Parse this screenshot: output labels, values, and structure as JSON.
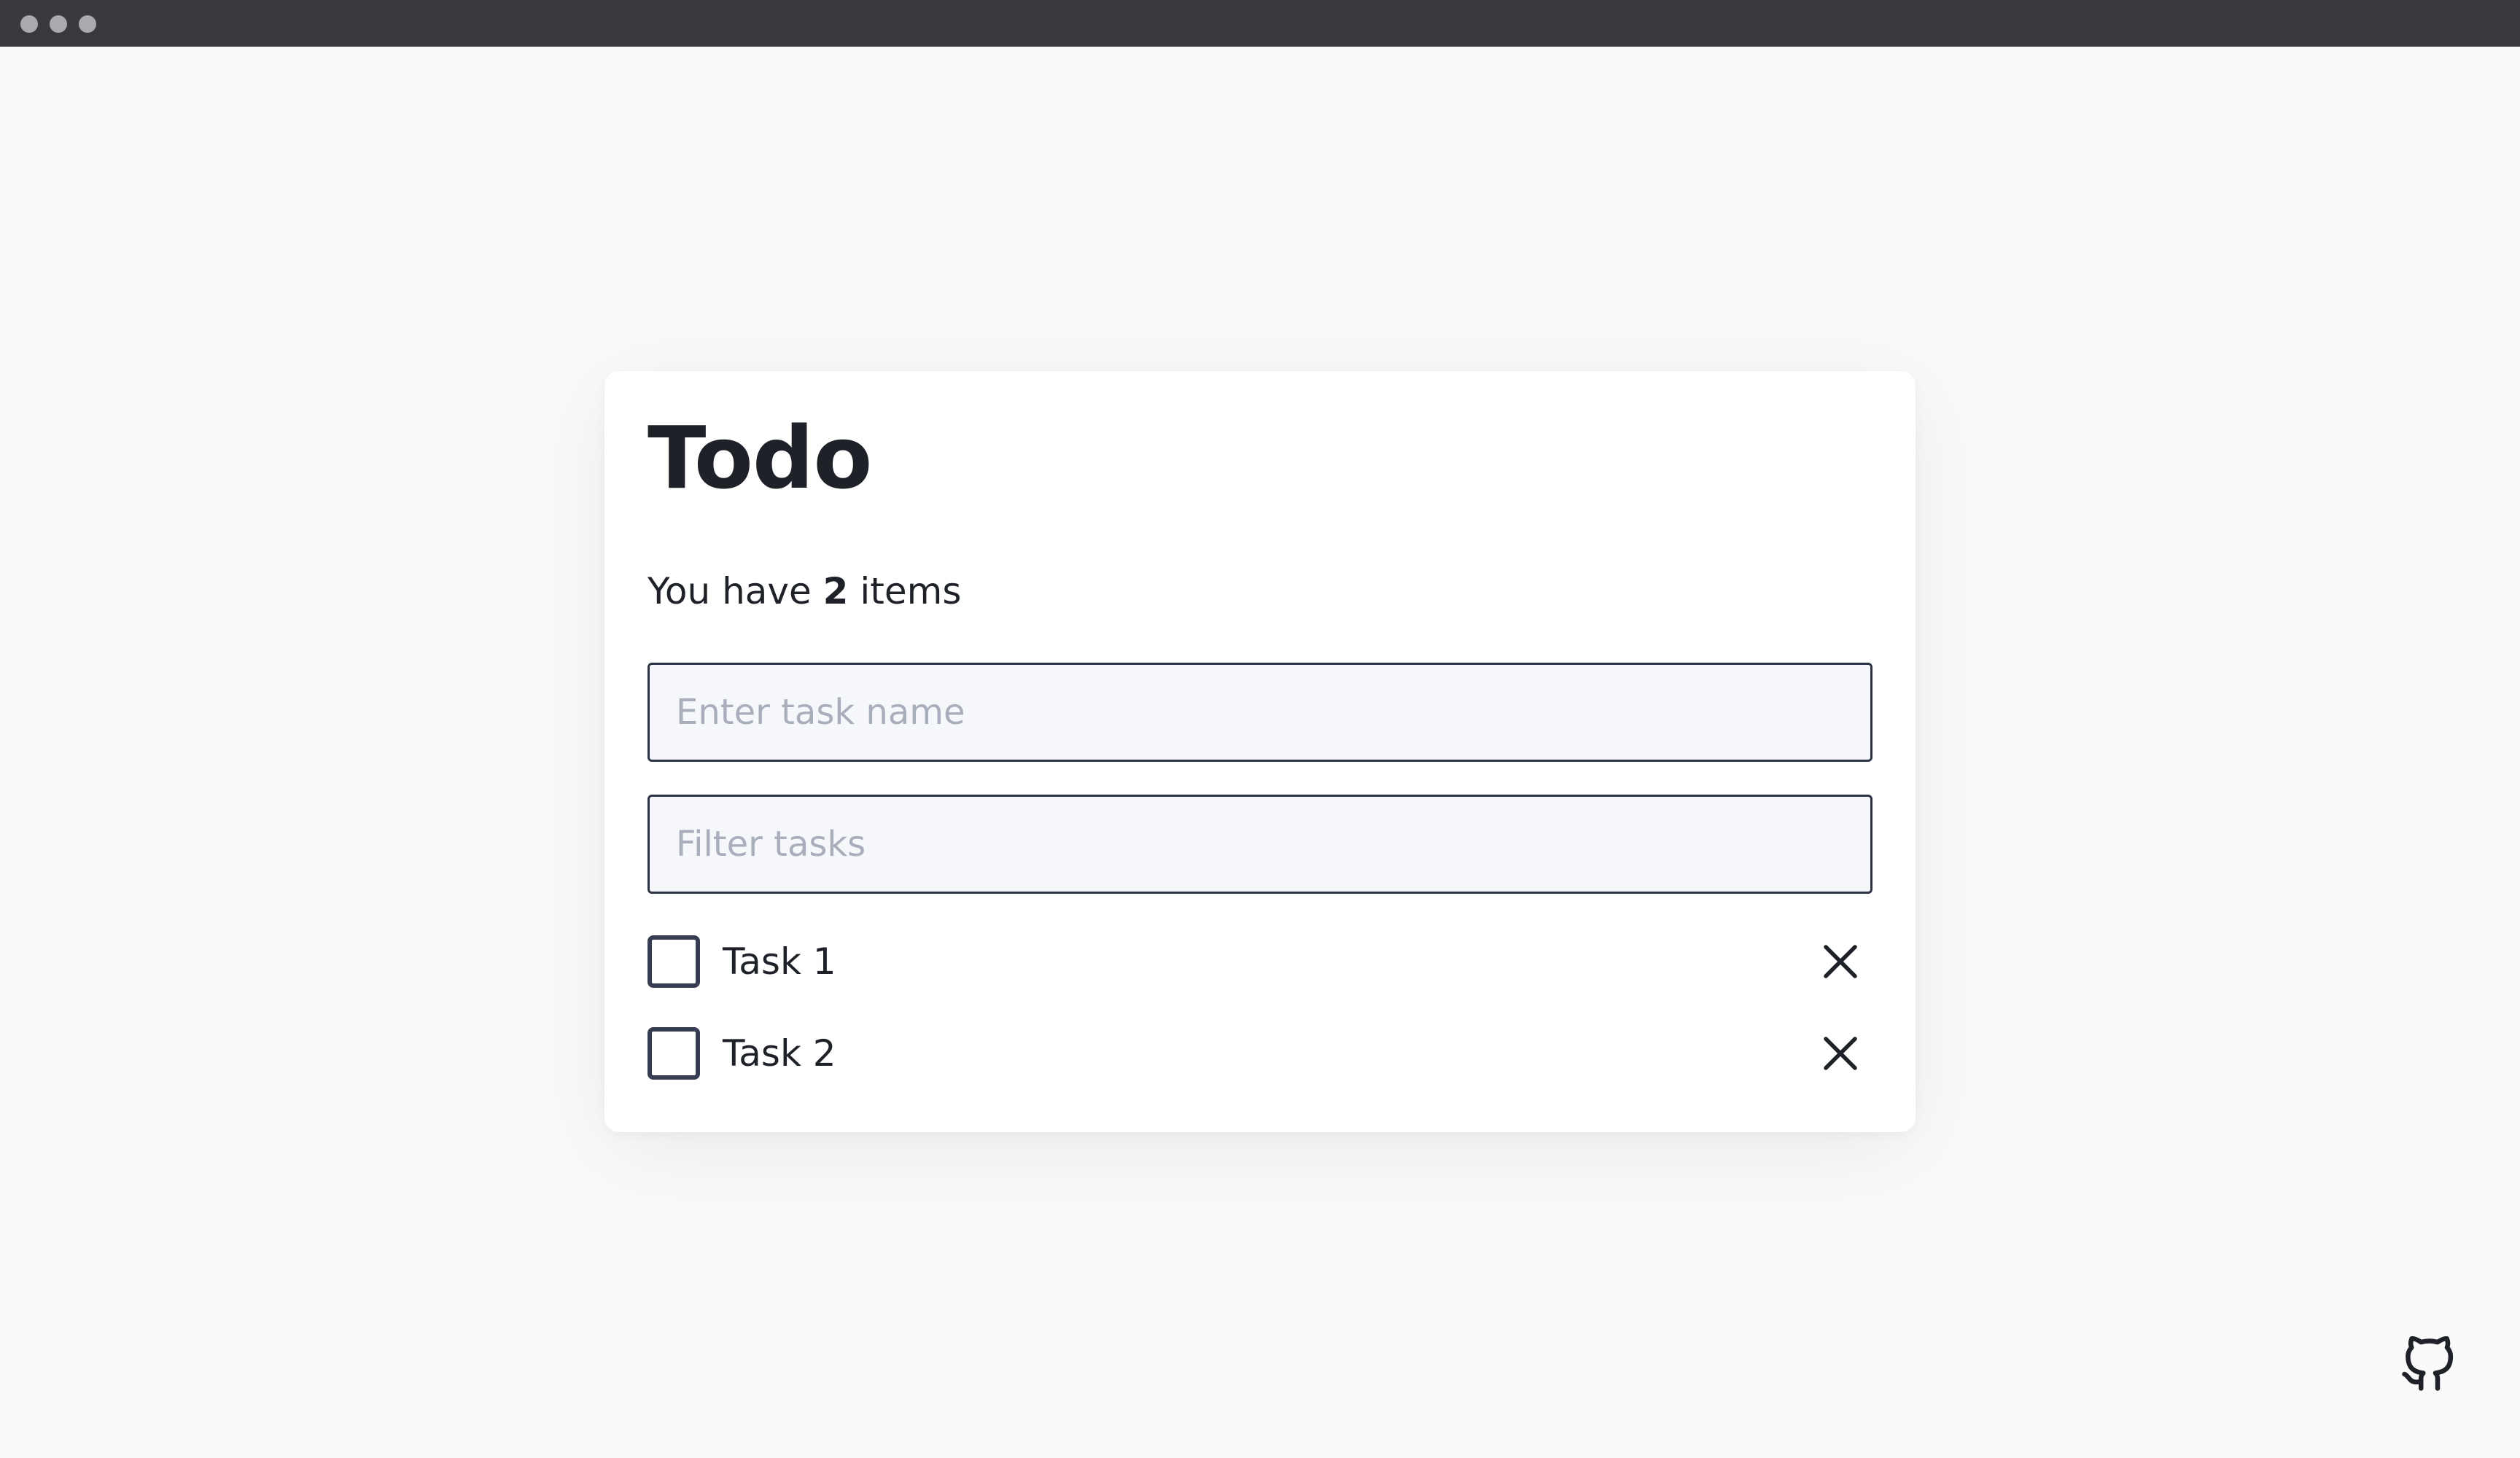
{
  "window": {
    "controls": [
      "close",
      "minimize",
      "maximize"
    ]
  },
  "todo": {
    "title": "Todo",
    "count_prefix": "You have",
    "count": "2",
    "count_suffix": "items",
    "new_task_placeholder": "Enter task name",
    "filter_placeholder": "Filter tasks",
    "tasks": [
      {
        "label": "Task 1",
        "completed": false
      },
      {
        "label": "Task 2",
        "completed": false
      }
    ],
    "delete_icon": "close-icon"
  },
  "footer": {
    "github_icon": "github-icon"
  },
  "colors": {
    "page_background": "#fafafa",
    "card_background": "#ffffff",
    "titlebar": "#38393c",
    "text": "#1e2128",
    "input_border": "#2c3345",
    "input_background": "#f5f7fa",
    "placeholder": "#a8aebc",
    "checkbox_border": "#363d52"
  }
}
